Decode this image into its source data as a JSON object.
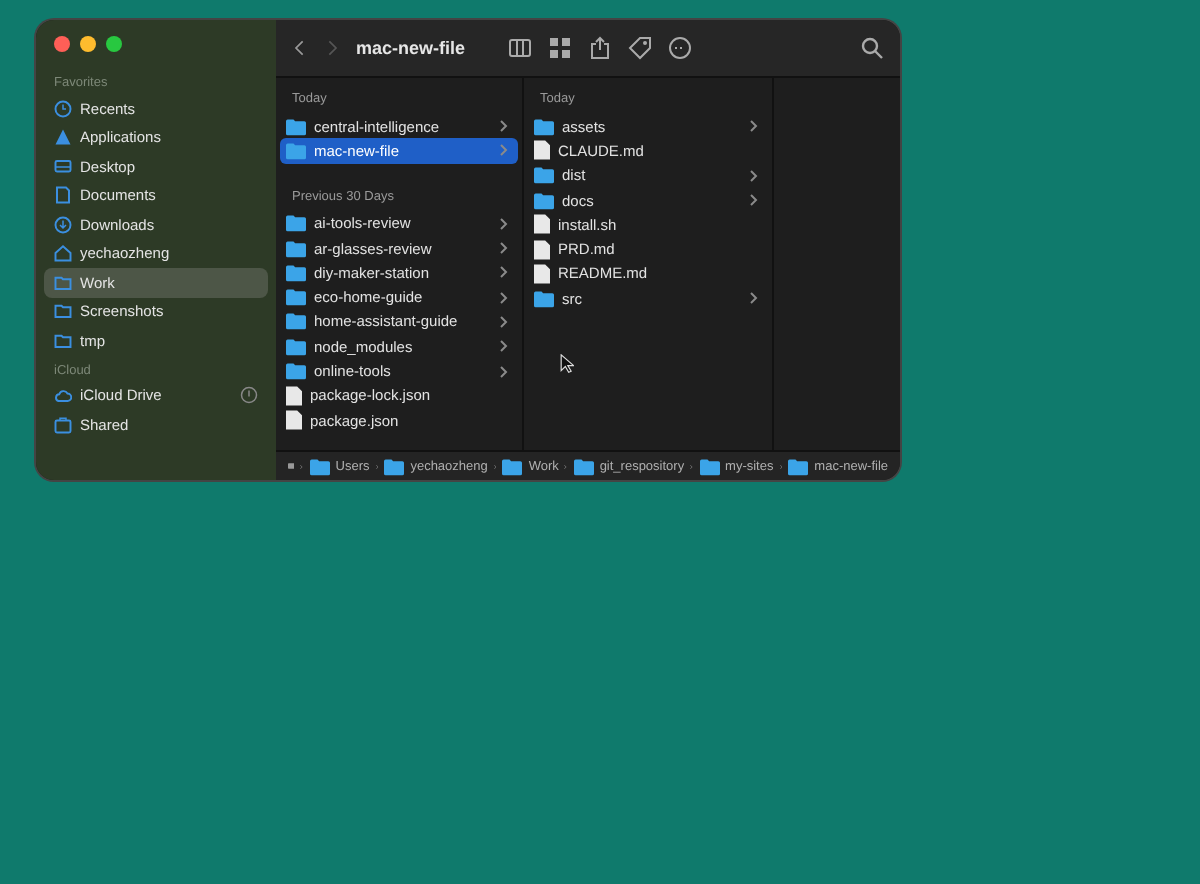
{
  "window": {
    "title": "mac-new-file"
  },
  "sidebar": {
    "sections": [
      {
        "title": "Favorites",
        "items": [
          {
            "label": "Recents",
            "kind": "clock",
            "selected": false
          },
          {
            "label": "Applications",
            "kind": "apps",
            "selected": false
          },
          {
            "label": "Desktop",
            "kind": "desktop",
            "selected": false
          },
          {
            "label": "Documents",
            "kind": "document",
            "selected": false
          },
          {
            "label": "Downloads",
            "kind": "download",
            "selected": false
          },
          {
            "label": "yechaozheng",
            "kind": "home",
            "selected": false
          },
          {
            "label": "Work",
            "kind": "folder",
            "selected": true
          },
          {
            "label": "Screenshots",
            "kind": "folder",
            "selected": false
          },
          {
            "label": "tmp",
            "kind": "folder",
            "selected": false
          }
        ]
      },
      {
        "title": "iCloud",
        "items": [
          {
            "label": "iCloud Drive",
            "kind": "cloud",
            "selected": false,
            "syncing": true
          },
          {
            "label": "Shared",
            "kind": "shared",
            "selected": false
          }
        ]
      }
    ]
  },
  "columns": [
    {
      "groups": [
        {
          "title": "Today",
          "items": [
            {
              "name": "central-intelligence",
              "kind": "folder",
              "selected": false
            },
            {
              "name": "mac-new-file",
              "kind": "folder",
              "selected": true
            }
          ]
        },
        {
          "title": "Previous 30 Days",
          "items": [
            {
              "name": "ai-tools-review",
              "kind": "folder",
              "selected": false
            },
            {
              "name": "ar-glasses-review",
              "kind": "folder",
              "selected": false
            },
            {
              "name": "diy-maker-station",
              "kind": "folder",
              "selected": false
            },
            {
              "name": "eco-home-guide",
              "kind": "folder",
              "selected": false
            },
            {
              "name": "home-assistant-guide",
              "kind": "folder",
              "selected": false
            },
            {
              "name": "node_modules",
              "kind": "folder",
              "selected": false
            },
            {
              "name": "online-tools",
              "kind": "folder",
              "selected": false
            },
            {
              "name": "package-lock.json",
              "kind": "file",
              "selected": false
            },
            {
              "name": "package.json",
              "kind": "file",
              "selected": false
            }
          ]
        }
      ]
    },
    {
      "groups": [
        {
          "title": "Today",
          "items": [
            {
              "name": "assets",
              "kind": "folder",
              "selected": false
            },
            {
              "name": "CLAUDE.md",
              "kind": "file",
              "selected": false
            },
            {
              "name": "dist",
              "kind": "folder",
              "selected": false
            },
            {
              "name": "docs",
              "kind": "folder",
              "selected": false
            },
            {
              "name": "install.sh",
              "kind": "file",
              "selected": false
            },
            {
              "name": "PRD.md",
              "kind": "file",
              "selected": false
            },
            {
              "name": "README.md",
              "kind": "file",
              "selected": false
            },
            {
              "name": "src",
              "kind": "folder",
              "selected": false
            }
          ]
        }
      ]
    }
  ],
  "path_bar": [
    "Users",
    "yechaozheng",
    "Work",
    "git_respository",
    "my-sites",
    "mac-new-file"
  ]
}
